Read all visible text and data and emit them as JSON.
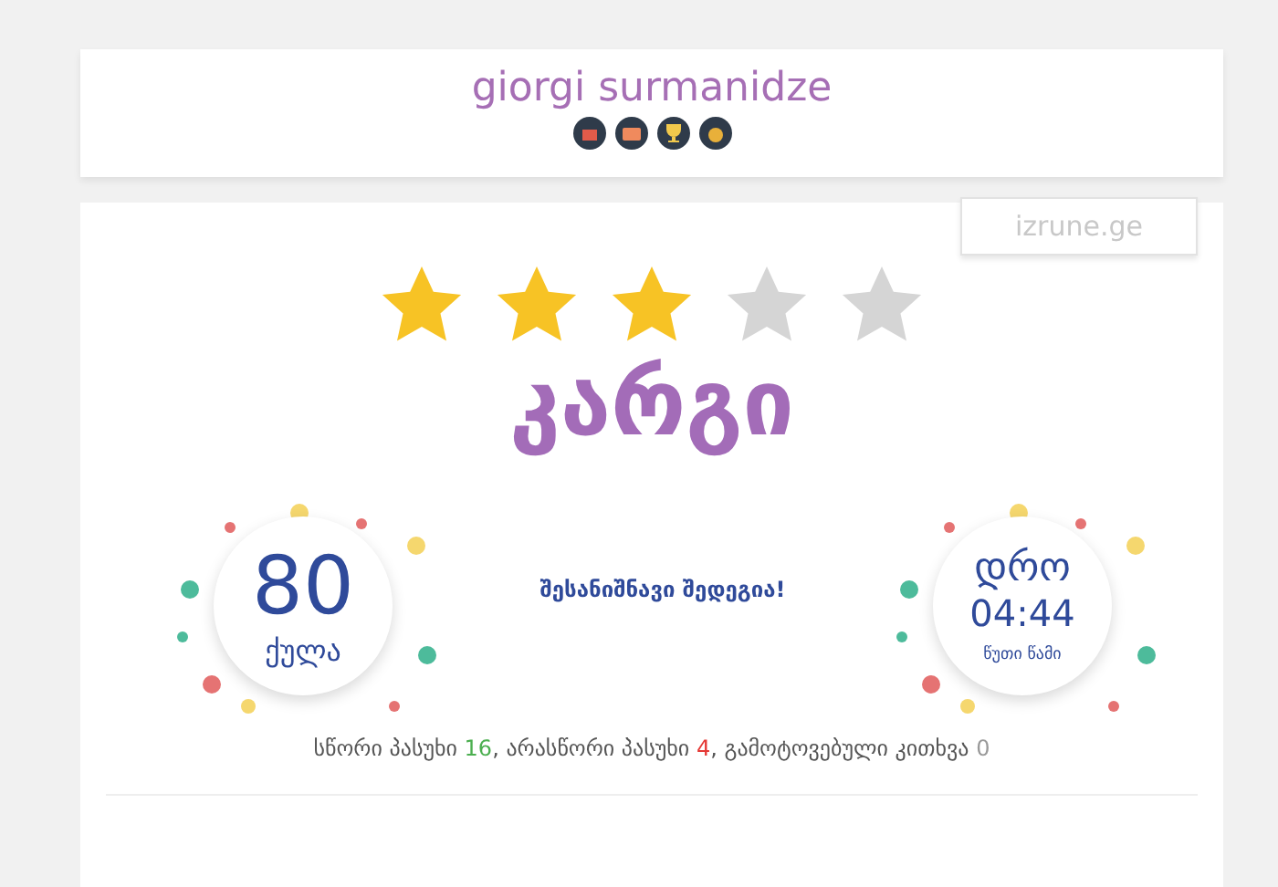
{
  "header": {
    "name": "giorgi surmanidze",
    "badges": [
      {
        "kind": "gift"
      },
      {
        "kind": "book"
      },
      {
        "kind": "trophy"
      },
      {
        "kind": "medal"
      }
    ]
  },
  "site_button": {
    "label": "izrune.ge"
  },
  "rating": {
    "stars": 3,
    "verdict": "კარგი"
  },
  "score": {
    "value": "80",
    "unit": "ქულა"
  },
  "message": "შესანიშნავი შედეგია!",
  "time": {
    "label": "დრო",
    "value": "04:44",
    "unit": "წუთი წამი"
  },
  "summary": [
    {
      "kind": "correct",
      "label": "სწორი პასუხი",
      "value": "16"
    },
    {
      "kind": "wrong",
      "label": ", არასწორი პასუხი",
      "value": "4"
    },
    {
      "kind": "skipped",
      "label": ", გამოტოვებული კითხვა",
      "value": "0"
    }
  ]
}
